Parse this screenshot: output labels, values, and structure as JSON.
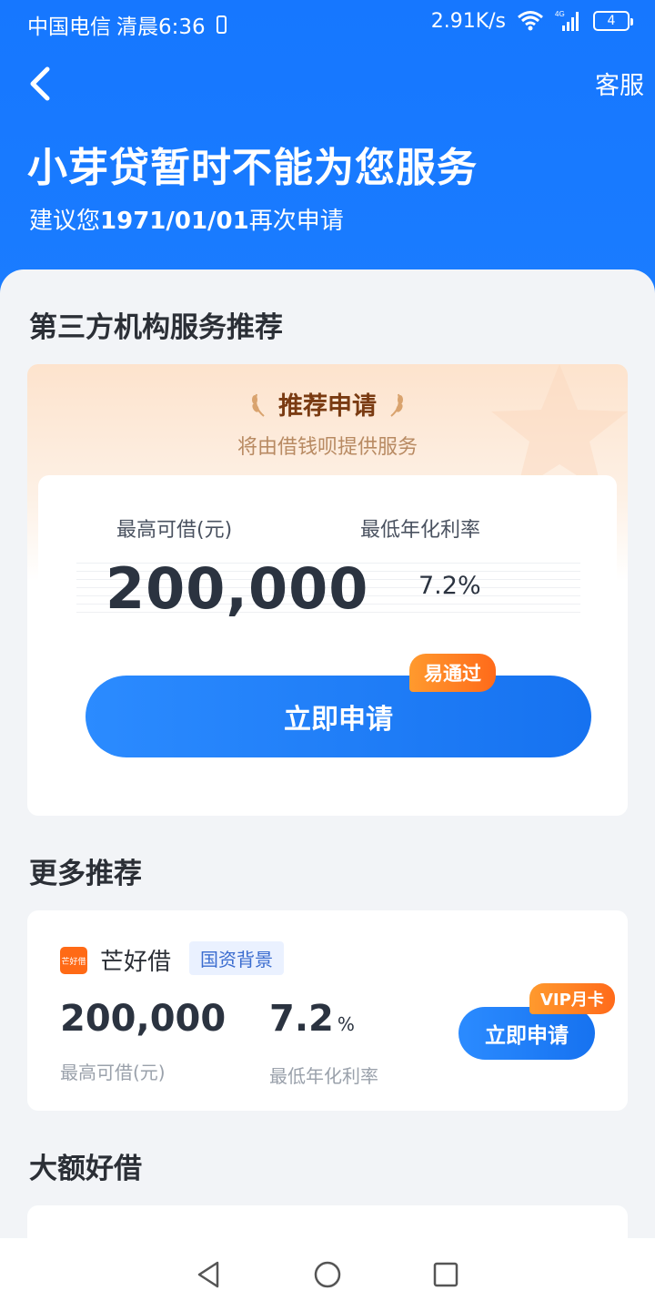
{
  "status_bar": {
    "carrier": "中国电信",
    "time": "清晨6:36",
    "net_speed": "2.91K/s",
    "network": "4G",
    "battery": "4"
  },
  "header": {
    "back_icon": "chevron-left-icon",
    "service_label": "客服",
    "title": "小芽贷暂时不能为您服务",
    "subtitle_prefix": "建议您",
    "subtitle_date": "1971/01/01",
    "subtitle_suffix": "再次申请"
  },
  "recommend": {
    "section_title": "第三方机构服务推荐",
    "card_title": "推荐申请",
    "card_subtitle": "将由借钱呗提供服务",
    "amount_label": "最高可借(元)",
    "rate_label": "最低年化利率",
    "amount": "200,000",
    "rate": "7.2%",
    "apply_label": "立即申请",
    "badge": "易通过"
  },
  "more": {
    "section_title": "更多推荐",
    "product_logo_text": "芒好借",
    "product_name": "芒好借",
    "product_tag": "国资背景",
    "amount": "200,000",
    "amount_label": "最高可借(元)",
    "rate": "7.2",
    "rate_unit": "%",
    "rate_label": "最低年化利率",
    "apply_label": "立即申请",
    "badge": "VIP月卡"
  },
  "big_loan": {
    "section_title": "大额好借"
  },
  "colors": {
    "primary_blue": "#1677ff",
    "accent_orange": "#ff7a1f",
    "background": "#f2f4f7"
  }
}
